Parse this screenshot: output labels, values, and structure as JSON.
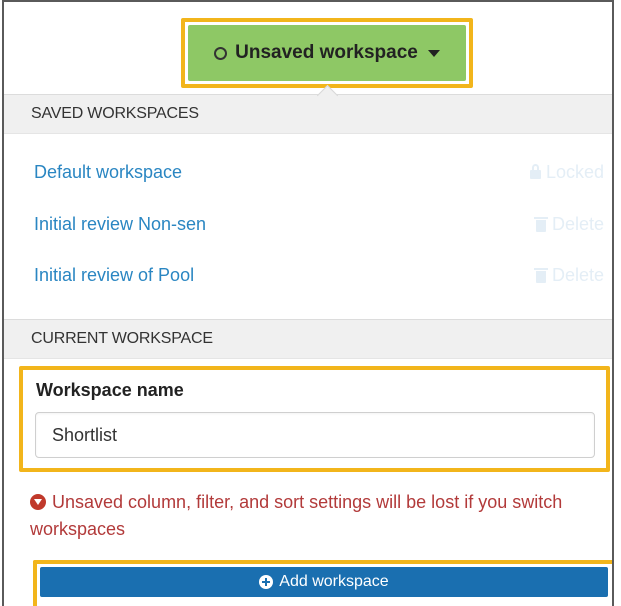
{
  "header": {
    "workspace_button_label": "Unsaved workspace"
  },
  "saved_section": {
    "title": "SAVED WORKSPACES",
    "items": [
      {
        "name": "Default workspace",
        "action": "Locked",
        "action_icon": "lock-icon"
      },
      {
        "name": "Initial review Non-sen",
        "action": "Delete",
        "action_icon": "trash-icon"
      },
      {
        "name": "Initial review of Pool",
        "action": "Delete",
        "action_icon": "trash-icon"
      }
    ]
  },
  "current_section": {
    "title": "CURRENT WORKSPACE",
    "name_label": "Workspace name",
    "name_value": "Shortlist",
    "warning": "Unsaved column, filter, and sort settings will be lost if you switch workspaces",
    "add_button_label": "Add workspace"
  },
  "colors": {
    "workspace_button": "#8ec865",
    "highlight_border": "#f2b51b",
    "link": "#2a86c2",
    "warning": "#b23a3a",
    "add_button": "#1a6fb0"
  }
}
